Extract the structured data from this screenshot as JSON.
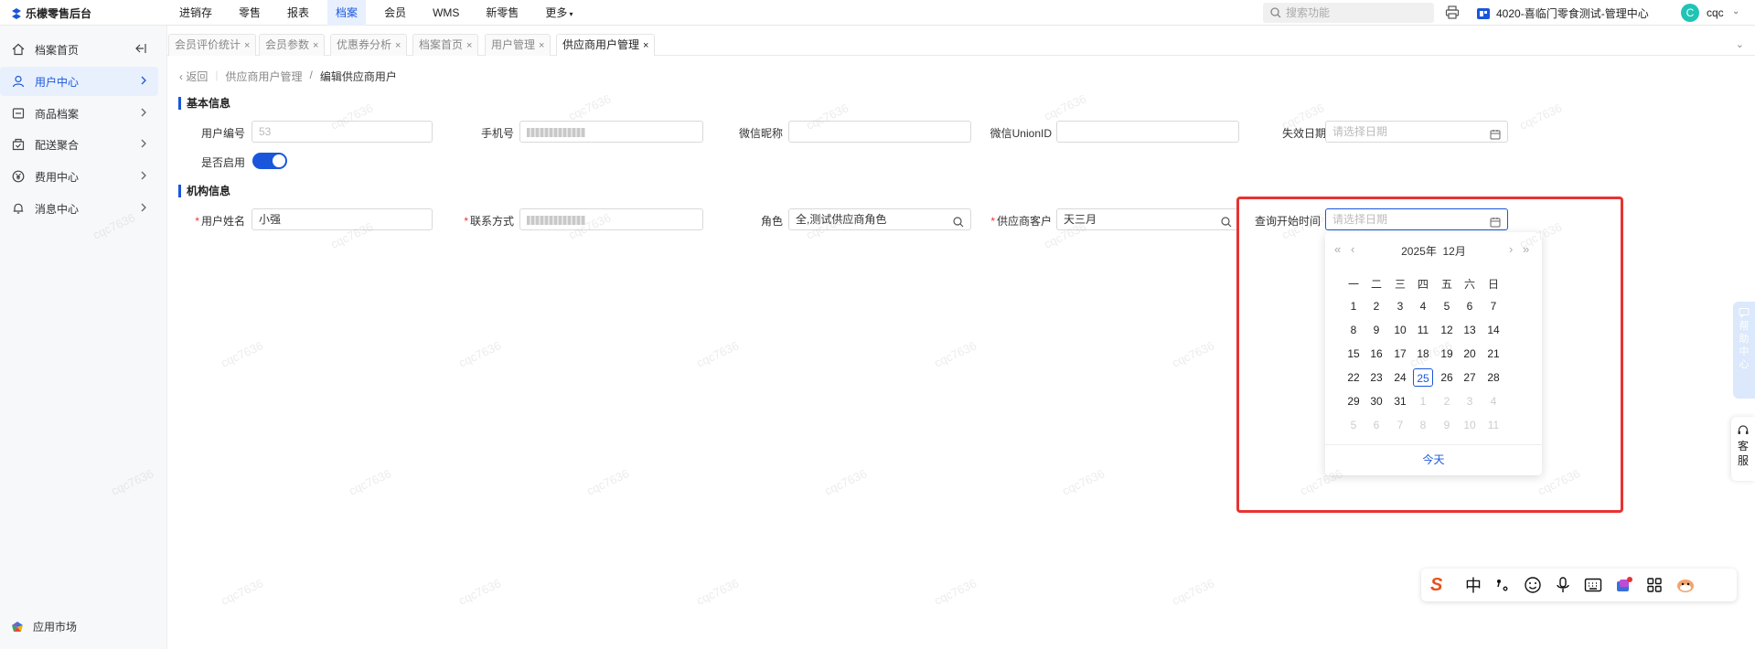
{
  "app": {
    "title": "乐檬零售后台"
  },
  "topnav": [
    "进销存",
    "零售",
    "报表",
    "档案",
    "会员",
    "WMS",
    "新零售",
    "更多"
  ],
  "header": {
    "search_placeholder": "搜索功能",
    "store_name": "4020-喜临门零食测试-管理中心",
    "avatar_letter": "C",
    "username": "cqc"
  },
  "sidebar": {
    "items": [
      {
        "label": "档案首页"
      },
      {
        "label": "用户中心"
      },
      {
        "label": "商品档案"
      },
      {
        "label": "配送聚合"
      },
      {
        "label": "费用中心"
      },
      {
        "label": "消息中心"
      }
    ],
    "bottom_label": "应用市场"
  },
  "tabs": [
    {
      "label": "会员评价统计"
    },
    {
      "label": "会员参数"
    },
    {
      "label": "优惠券分析"
    },
    {
      "label": "档案首页"
    },
    {
      "label": "用户管理"
    },
    {
      "label": "供应商用户管理"
    }
  ],
  "breadcrumb": {
    "back": "返回",
    "parent": "供应商用户管理",
    "sep": "/",
    "current": "编辑供应商用户"
  },
  "form": {
    "basic_title": "基本信息",
    "org_title": "机构信息",
    "labels": {
      "user_no": "用户编号",
      "phone": "手机号",
      "wechat_nick": "微信昵称",
      "wechat_union": "微信UnionID",
      "expire": "失效日期",
      "enabled": "是否启用",
      "user_name": "用户姓名",
      "contact": "联系方式",
      "role": "角色",
      "supplier": "供应商客户",
      "query_start": "查询开始时间"
    },
    "values": {
      "user_no": "53",
      "user_name": "小强",
      "role": "全,测试供应商角色",
      "supplier": "天三月"
    },
    "date_placeholder": "请选择日期",
    "enabled": true
  },
  "calendar": {
    "year_label": "2025年",
    "month_label": "12月",
    "weekdays": [
      "一",
      "二",
      "三",
      "四",
      "五",
      "六",
      "日"
    ],
    "days": [
      [
        "1",
        "2",
        "3",
        "4",
        "5",
        "6",
        "7"
      ],
      [
        "8",
        "9",
        "10",
        "11",
        "12",
        "13",
        "14"
      ],
      [
        "15",
        "16",
        "17",
        "18",
        "19",
        "20",
        "21"
      ],
      [
        "22",
        "23",
        "24",
        "25",
        "26",
        "27",
        "28"
      ],
      [
        "29",
        "30",
        "31",
        "1",
        "2",
        "3",
        "4"
      ],
      [
        "5",
        "6",
        "7",
        "8",
        "9",
        "10",
        "11"
      ]
    ],
    "today_day": "25",
    "today_label": "今天"
  },
  "right_tabs": {
    "help": "帮助中心",
    "service": "客服"
  },
  "ime": {
    "lang": "中"
  },
  "watermark": "cqc7636"
}
